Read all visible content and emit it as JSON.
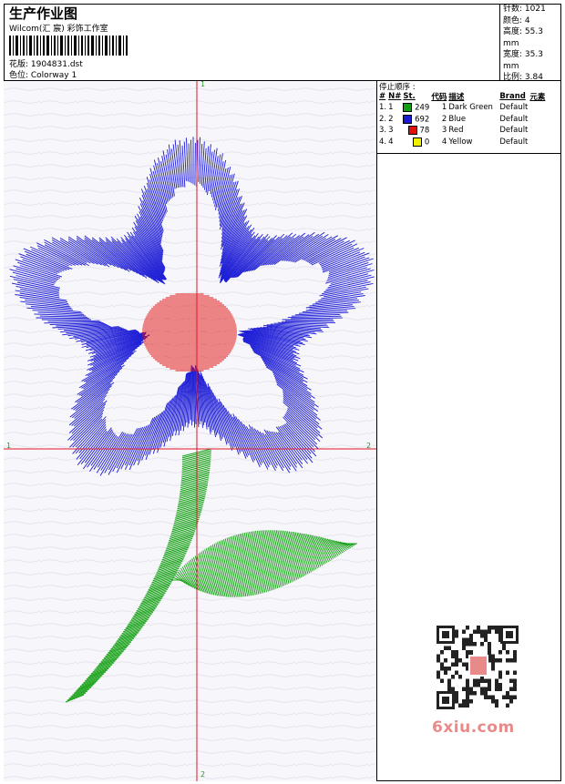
{
  "header": {
    "title": "生产作业图",
    "subtitle": "Wilcom(汇 宸) 彩饰工作室",
    "design_label": "花版: 1904831.dst",
    "colorway_label": "色位: Colorway 1"
  },
  "stats": {
    "stitches": "针数: 1021",
    "colors": "颜色: 4",
    "height": "高度: 55.3 mm",
    "width": "宽度: 35.3 mm",
    "scale": "比例: 3.84"
  },
  "stop_sequence": {
    "title": "停止顺序 :",
    "columns": [
      "#",
      "N#",
      "St.",
      "代码",
      "描述",
      "Brand",
      "元素"
    ],
    "rows": [
      {
        "idx": "1.",
        "n": "1",
        "color": "#11a011",
        "st": "249",
        "code": "1",
        "desc": "Dark Green",
        "brand": "Default"
      },
      {
        "idx": "2.",
        "n": "2",
        "color": "#1a1ad6",
        "st": "692",
        "code": "2",
        "desc": "Blue",
        "brand": "Default"
      },
      {
        "idx": "3.",
        "n": "3",
        "color": "#e01010",
        "st": "78",
        "code": "3",
        "desc": "Red",
        "brand": "Default"
      },
      {
        "idx": "4.",
        "n": "4",
        "color": "#f2f200",
        "st": "0",
        "code": "4",
        "desc": "Yellow",
        "brand": "Default"
      }
    ]
  },
  "canvas": {
    "axis_top": "1",
    "axis_bottom": "2",
    "axis_left": "1",
    "axis_right": "2",
    "thread_colors": {
      "green": "#11a011",
      "blue": "#1a1ad6",
      "red": "#e01010",
      "guide": "#e0182a"
    }
  },
  "watermark": {
    "site": "6xiu.com"
  }
}
